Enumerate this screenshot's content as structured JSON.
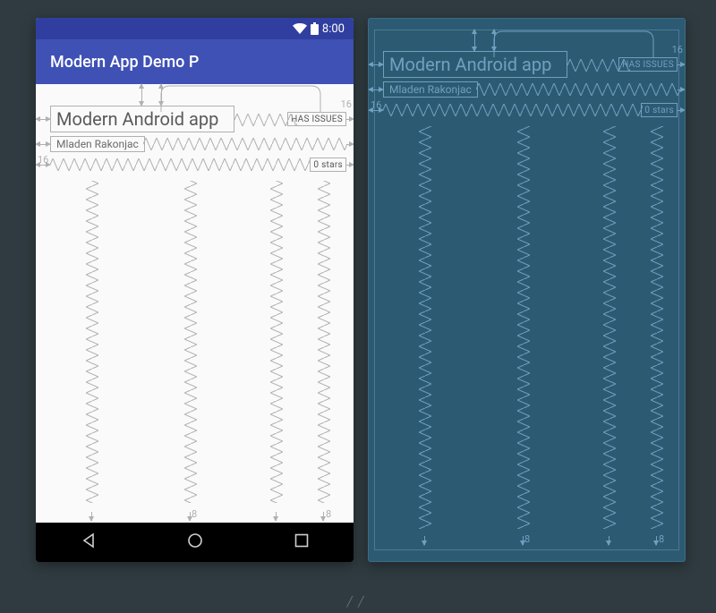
{
  "status": {
    "time": "8:00"
  },
  "appbar": {
    "title": "Modern App Demo P"
  },
  "views": {
    "title": {
      "text": "Modern Android app"
    },
    "hasIssues": {
      "text": "HAS ISSUES"
    },
    "author": {
      "text": "Mladen Rakonjac"
    },
    "stars": {
      "text": "0 stars"
    }
  },
  "margins": {
    "top_title": "16",
    "top_issues": "16",
    "left_author": "16",
    "bottom_spring": "8"
  }
}
